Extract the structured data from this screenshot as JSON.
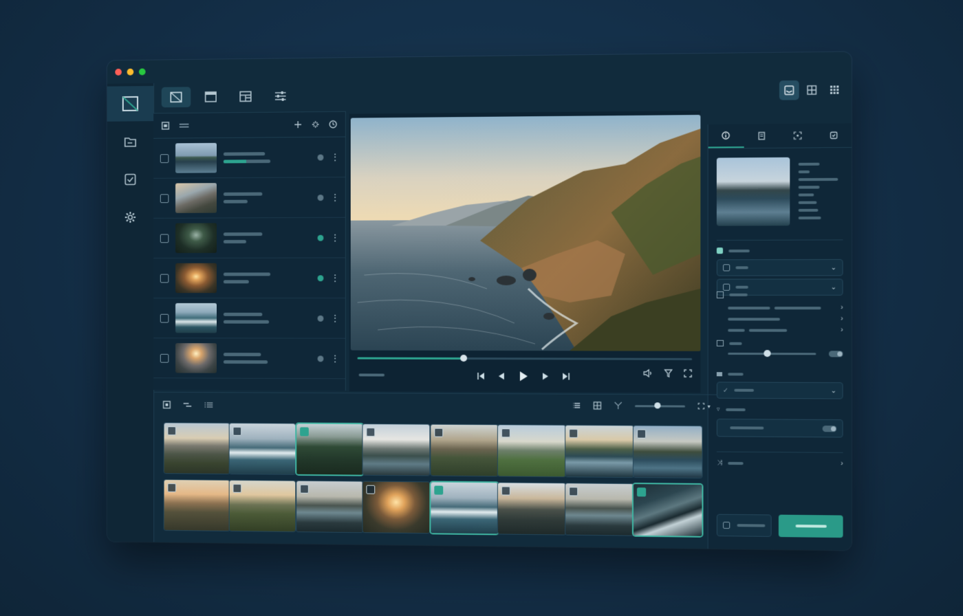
{
  "window": {
    "traffic_lights": [
      {
        "name": "close",
        "color": "#ff5f57"
      },
      {
        "name": "minimize",
        "color": "#febc2e"
      },
      {
        "name": "zoom",
        "color": "#28c840"
      }
    ]
  },
  "rail": {
    "items": [
      {
        "icon": "image-view-icon",
        "active": true
      },
      {
        "icon": "folder-icon",
        "active": false
      },
      {
        "icon": "checkbox-icon",
        "active": false
      },
      {
        "icon": "gear-icon",
        "active": false
      }
    ]
  },
  "toolbar": {
    "tabs": [
      {
        "icon": "image-view-icon",
        "active": true
      },
      {
        "icon": "panel-icon",
        "active": false
      },
      {
        "icon": "layout-icon",
        "active": false
      },
      {
        "icon": "sliders-icon",
        "active": false
      }
    ],
    "view_modes": [
      {
        "icon": "inbox-icon",
        "active": true
      },
      {
        "icon": "grid-2x2-icon",
        "active": false
      },
      {
        "icon": "grid-3x3-icon",
        "active": false
      }
    ]
  },
  "list": {
    "rows": [
      {
        "thumb": "coast",
        "status": "idle"
      },
      {
        "thumb": "mountain",
        "status": "idle"
      },
      {
        "thumb": "forest",
        "status": "active"
      },
      {
        "thumb": "sunset",
        "status": "active"
      },
      {
        "thumb": "wave",
        "status": "idle"
      },
      {
        "thumb": "dusk",
        "status": "idle"
      }
    ]
  },
  "viewer": {
    "progress": 0.32,
    "controls": [
      "skip-back-icon",
      "prev-icon",
      "play-icon",
      "next-icon",
      "skip-forward-icon"
    ],
    "tools": [
      "volume-icon",
      "filter-icon",
      "fullscreen-icon"
    ]
  },
  "inspector": {
    "tabs": [
      "info-icon",
      "document-icon",
      "focus-icon",
      "tag-icon"
    ],
    "active_tab": 0,
    "slider_value": 0.45
  },
  "filmstrip": {
    "zoom_value": 0.45,
    "thumbs": [
      {
        "scene": "mountain",
        "selected": false
      },
      {
        "scene": "wave",
        "selected": false
      },
      {
        "scene": "forest",
        "selected": true
      },
      {
        "scene": "mountain-lake",
        "selected": false
      },
      {
        "scene": "peak",
        "selected": false
      },
      {
        "scene": "meadow",
        "selected": false
      },
      {
        "scene": "lake",
        "selected": false
      },
      {
        "scene": "coast",
        "selected": false
      },
      {
        "scene": "sunset-peak",
        "selected": false
      },
      {
        "scene": "hills",
        "selected": false
      },
      {
        "scene": "lake-dusk",
        "selected": false
      },
      {
        "scene": "sunset",
        "selected": false
      },
      {
        "scene": "wave",
        "selected": true
      },
      {
        "scene": "ridge",
        "selected": false
      },
      {
        "scene": "lake-dusk",
        "selected": false
      },
      {
        "scene": "night-coast",
        "selected": true
      }
    ]
  },
  "colors": {
    "accent": "#2da38f",
    "panel": "#0f2738",
    "background": "#14304a"
  }
}
